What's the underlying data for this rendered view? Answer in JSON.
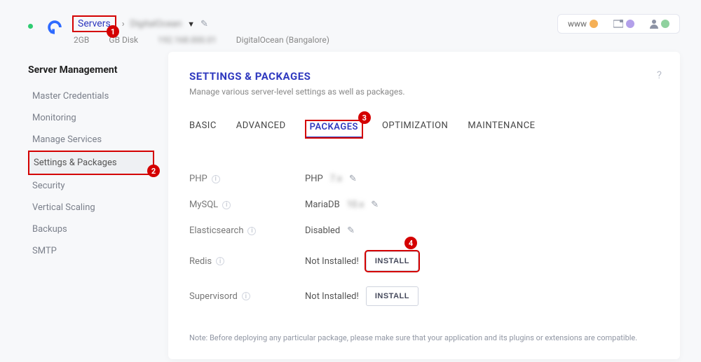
{
  "header": {
    "breadcrumb_servers": "Servers",
    "server_name": "DigitalOcean",
    "ram": "2GB",
    "disk": "GB Disk",
    "ip": "192.168.000.01",
    "provider": "DigitalOcean (Bangalore)",
    "www_label": "www"
  },
  "sidebar": {
    "title": "Server Management",
    "items": [
      {
        "label": "Master Credentials"
      },
      {
        "label": "Monitoring"
      },
      {
        "label": "Manage Services"
      },
      {
        "label": "Settings & Packages"
      },
      {
        "label": "Security"
      },
      {
        "label": "Vertical Scaling"
      },
      {
        "label": "Backups"
      },
      {
        "label": "SMTP"
      }
    ]
  },
  "panel": {
    "title": "SETTINGS & PACKAGES",
    "subtitle": "Manage various server-level settings as well as packages.",
    "tabs": {
      "basic": "BASIC",
      "advanced": "ADVANCED",
      "packages": "PACKAGES",
      "optimization": "OPTIMIZATION",
      "maintenance": "MAINTENANCE"
    },
    "packages": {
      "php_label": "PHP",
      "php_value": "PHP",
      "mysql_label": "MySQL",
      "mysql_value": "MariaDB",
      "elastic_label": "Elasticsearch",
      "elastic_value": "Disabled",
      "redis_label": "Redis",
      "redis_value": "Not Installed!",
      "supervisord_label": "Supervisord",
      "supervisord_value": "Not Installed!",
      "install_btn": "INSTALL"
    },
    "note": "Note: Before deploying any particular package, please make sure that your application and its plugins or extensions are compatible."
  },
  "annotations": {
    "a1": "1",
    "a2": "2",
    "a3": "3",
    "a4": "4"
  }
}
